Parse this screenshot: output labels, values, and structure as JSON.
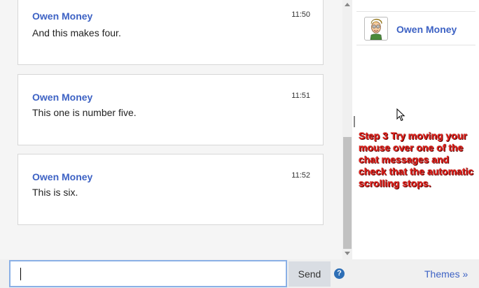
{
  "chat": {
    "messages": [
      {
        "author": "Owen Money",
        "time": "11:50",
        "text": "And this makes four."
      },
      {
        "author": "Owen Money",
        "time": "11:51",
        "text": "This one is number five."
      },
      {
        "author": "Owen Money",
        "time": "11:52",
        "text": "This is six."
      }
    ]
  },
  "users": {
    "list": [
      {
        "name": "Owen Money"
      }
    ]
  },
  "annotation": {
    "text": "Step 3 Try moving your mouse over one of the chat messages and check that the automatic scrolling stops."
  },
  "composer": {
    "value": "",
    "placeholder": "",
    "send_label": "Send",
    "help_glyph": "?",
    "themes_label": "Themes »"
  },
  "colors": {
    "author": "#3d62c4",
    "annotation": "#e5211b",
    "input_border": "#8ab0e6",
    "send_bg": "#d9dde3"
  }
}
